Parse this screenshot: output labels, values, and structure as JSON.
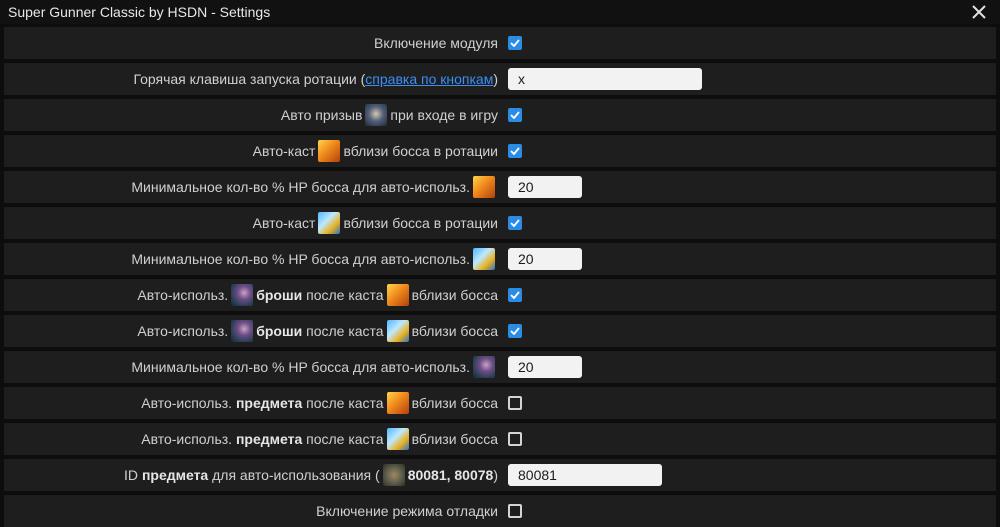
{
  "window": {
    "title": "Super Gunner Classic by HSDN - Settings"
  },
  "rows": [
    {
      "id": "enable_module",
      "text": "Включение модуля",
      "type": "checkbox",
      "checked": true
    },
    {
      "id": "hotkey",
      "text_before": "Горячая клавиша запуска ротации (",
      "link": "справка по кнопкам",
      "text_after": ")",
      "type": "text",
      "value": "x"
    },
    {
      "id": "auto_summon",
      "text_before": "Авто призыв",
      "icon": "summon-icon",
      "text_after": "при входе в игру",
      "type": "checkbox",
      "checked": true
    },
    {
      "id": "autocast_fire",
      "text_before": "Авто-каст",
      "icon": "fire-skill-icon",
      "text_after": "вблизи босса в ротации",
      "type": "checkbox",
      "checked": true
    },
    {
      "id": "min_hp_fire",
      "text": "Минимальное кол-во % HP босса для авто-использ.",
      "icon": "fire-skill-icon",
      "type": "text",
      "value": "20"
    },
    {
      "id": "autocast_light",
      "text_before": "Авто-каст",
      "icon": "lightning-skill-icon",
      "text_after": "вблизи босса в ротации",
      "type": "checkbox",
      "checked": true
    },
    {
      "id": "min_hp_light",
      "text": "Минимальное кол-во % HP босса для авто-использ.",
      "icon": "lightning-skill-icon",
      "type": "text",
      "value": "20"
    },
    {
      "id": "broach_fire",
      "text_before": "Авто-использ.",
      "bold": "броши",
      "text_mid": "после каста",
      "text_after": "вблизи босса",
      "type": "checkbox",
      "checked": true
    },
    {
      "id": "broach_light",
      "text_before": "Авто-использ.",
      "bold": "броши",
      "text_mid": "после каста",
      "text_after": "вблизи босса",
      "type": "checkbox",
      "checked": true
    },
    {
      "id": "min_hp_broach",
      "text": "Минимальное кол-во % HP босса для авто-использ.",
      "icon": "broach-icon",
      "type": "text",
      "value": "20"
    },
    {
      "id": "item_fire",
      "text_before": "Авто-использ.",
      "bold": "предмета",
      "text_mid": "после каста",
      "text_after": "вблизи босса",
      "type": "checkbox",
      "checked": false
    },
    {
      "id": "item_light",
      "text_before": "Авто-использ.",
      "bold": "предмета",
      "text_mid": "после каста",
      "text_after": "вблизи босса",
      "type": "checkbox",
      "checked": false
    },
    {
      "id": "item_id",
      "text_before": "ID",
      "bold": "предмета",
      "text_mid": "для авто-использования (",
      "bold2": "80081, 80078",
      "text_after": ")",
      "type": "text",
      "value": "80081"
    },
    {
      "id": "debug",
      "text": "Включение режима отладки",
      "type": "checkbox",
      "checked": false
    }
  ]
}
